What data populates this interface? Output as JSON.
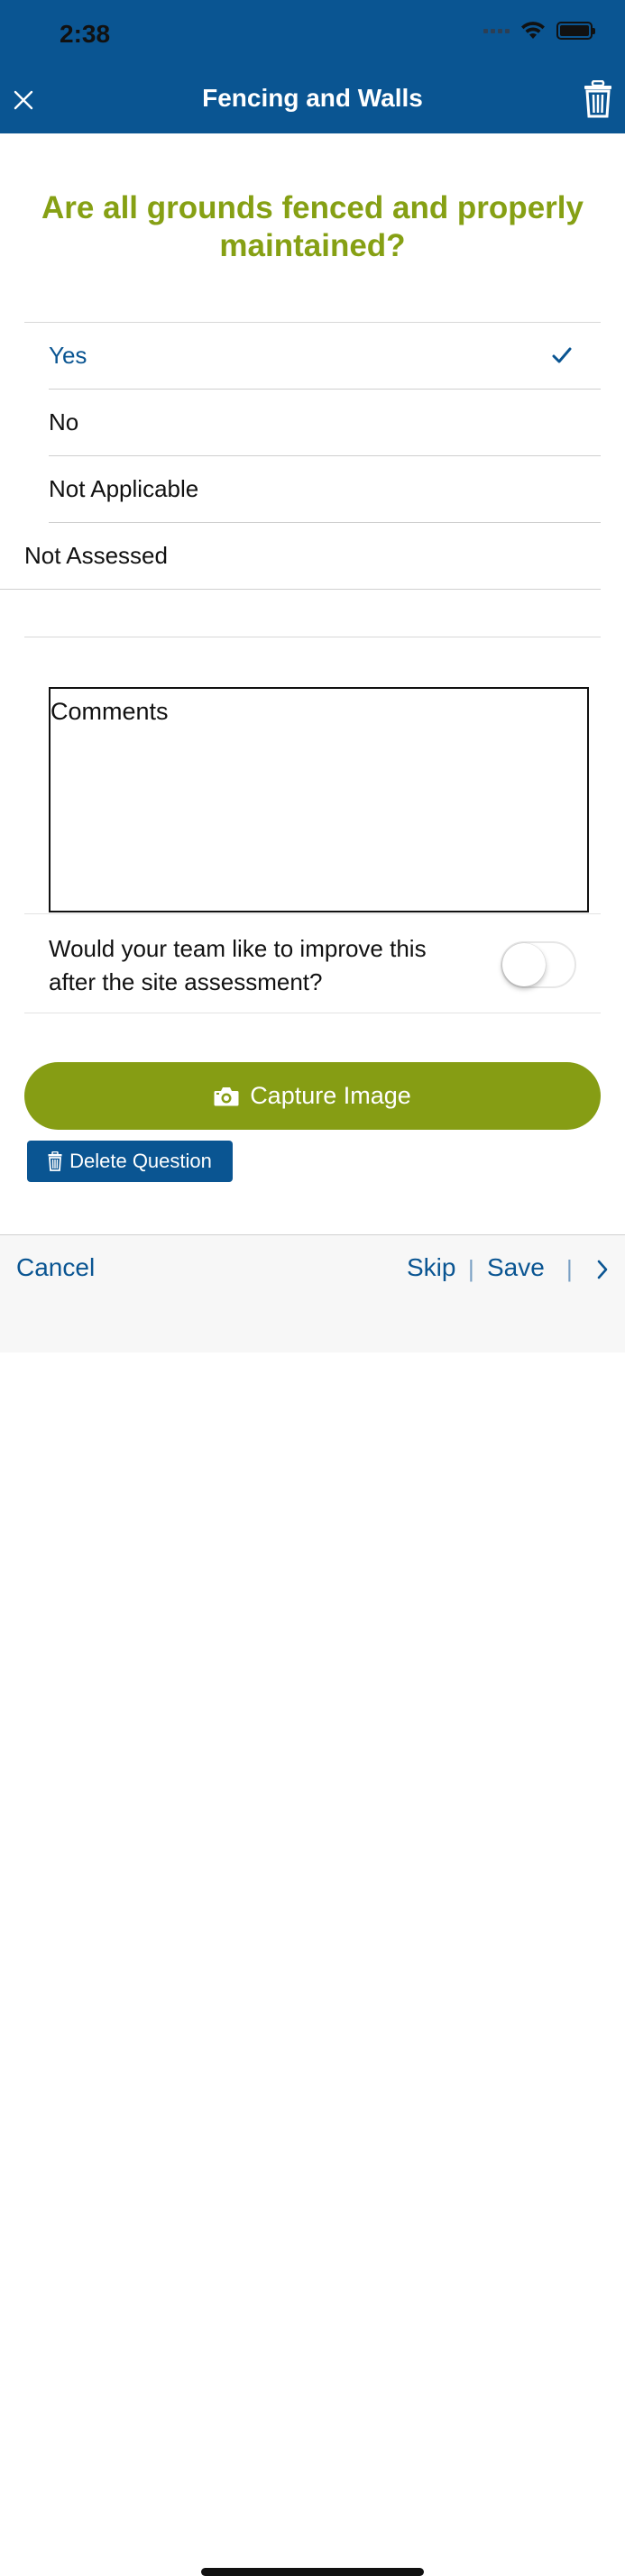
{
  "status_bar": {
    "time": "2:38"
  },
  "nav": {
    "title": "Fencing and Walls"
  },
  "question": {
    "text": "Are all grounds fenced and properly maintained?"
  },
  "options": [
    {
      "label": "Yes",
      "selected": true
    },
    {
      "label": "No",
      "selected": false
    },
    {
      "label": "Not Applicable",
      "selected": false
    },
    {
      "label": "Not Assessed",
      "selected": false
    }
  ],
  "comments": {
    "placeholder": "Comments",
    "value": ""
  },
  "improve": {
    "text": "Would your team like to improve this after the site assessment?",
    "enabled": false
  },
  "buttons": {
    "capture_label": "Capture Image",
    "delete_label": "Delete Question"
  },
  "toolbar": {
    "cancel_label": "Cancel",
    "skip_label": "Skip",
    "separator": "|",
    "save_label": "Save"
  },
  "colors": {
    "brand_blue": "#0a5592",
    "accent_green": "#86a014",
    "button_green": "#869d14"
  },
  "icons": {
    "close": "close-icon",
    "trash": "trash-icon",
    "check": "checkmark-icon",
    "camera": "camera-icon",
    "next": "chevron-right-icon"
  }
}
